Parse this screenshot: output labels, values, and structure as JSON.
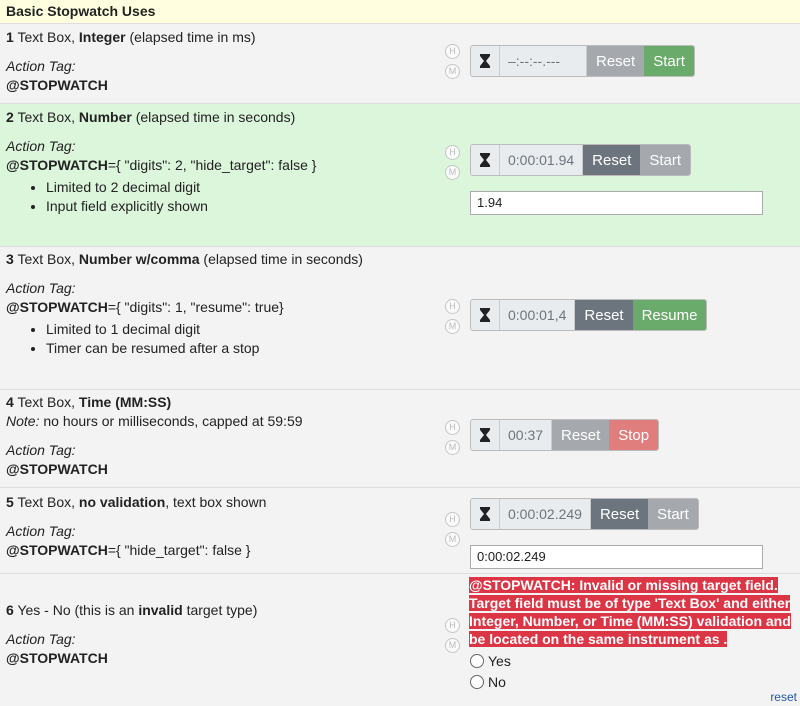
{
  "header": {
    "title": "Basic Stopwatch Uses"
  },
  "rows": [
    {
      "num": "1",
      "pre": "Text Box,",
      "bold": "Integer",
      "post": "(elapsed time in ms)",
      "action_label": "Action Tag:",
      "tag": "@STOPWATCH",
      "display": "–:--:--.---",
      "reset": "Reset",
      "action": "Start"
    },
    {
      "num": "2",
      "pre": "Text Box,",
      "bold": "Number",
      "post": "(elapsed time in seconds)",
      "action_label": "Action Tag:",
      "tag": "@STOPWATCH",
      "tag_rest": "={ \"digits\": 2, \"hide_target\": false }",
      "bullets": [
        "Limited to 2 decimal digit",
        "Input field explicitly shown"
      ],
      "display": "0:00:01.94",
      "reset": "Reset",
      "action": "Start",
      "input_value": "1.94"
    },
    {
      "num": "3",
      "pre": "Text Box,",
      "bold": "Number w/comma",
      "post": "(elapsed time in seconds)",
      "action_label": "Action Tag:",
      "tag": "@STOPWATCH",
      "tag_rest": "={ \"digits\": 1, \"resume\": true}",
      "bullets": [
        "Limited to 1 decimal digit",
        "Timer can be resumed after a stop"
      ],
      "display": "0:00:01,4",
      "reset": "Reset",
      "action": "Resume"
    },
    {
      "num": "4",
      "pre": "Text Box,",
      "bold": "Time (MM:SS)",
      "post": "",
      "note_label": "Note:",
      "note": "no hours or milliseconds, capped at 59:59",
      "action_label": "Action Tag:",
      "tag": "@STOPWATCH",
      "display": "00:37",
      "reset": "Reset",
      "action": "Stop"
    },
    {
      "num": "5",
      "pre": "Text Box,",
      "bold": "no validation",
      "post": ", text box shown",
      "action_label": "Action Tag:",
      "tag": "@STOPWATCH",
      "tag_rest": "={ \"hide_target\": false }",
      "display": "0:00:02.249",
      "reset": "Reset",
      "action": "Start",
      "input_value": "0:00:02.249"
    },
    {
      "num": "6",
      "pre": "Yes - No (this is an",
      "bold": "invalid",
      "post": "target type)",
      "action_label": "Action Tag:",
      "tag": "@STOPWATCH",
      "error": "@STOPWATCH: Invalid or missing target field. Target field must be of type 'Text Box' and either Integer, Number, or Time (MM:SS) validation and be located on the same instrument as .",
      "options": [
        "Yes",
        "No"
      ]
    }
  ],
  "hm": {
    "h": "H",
    "m": "M"
  },
  "reset_link": "reset",
  "colors": {
    "header_bg": "#ffffe0",
    "highlight_row": "#dcf6dc",
    "start": "#6aaa6a",
    "stop": "#e07e7e",
    "error": "#dc3545"
  }
}
